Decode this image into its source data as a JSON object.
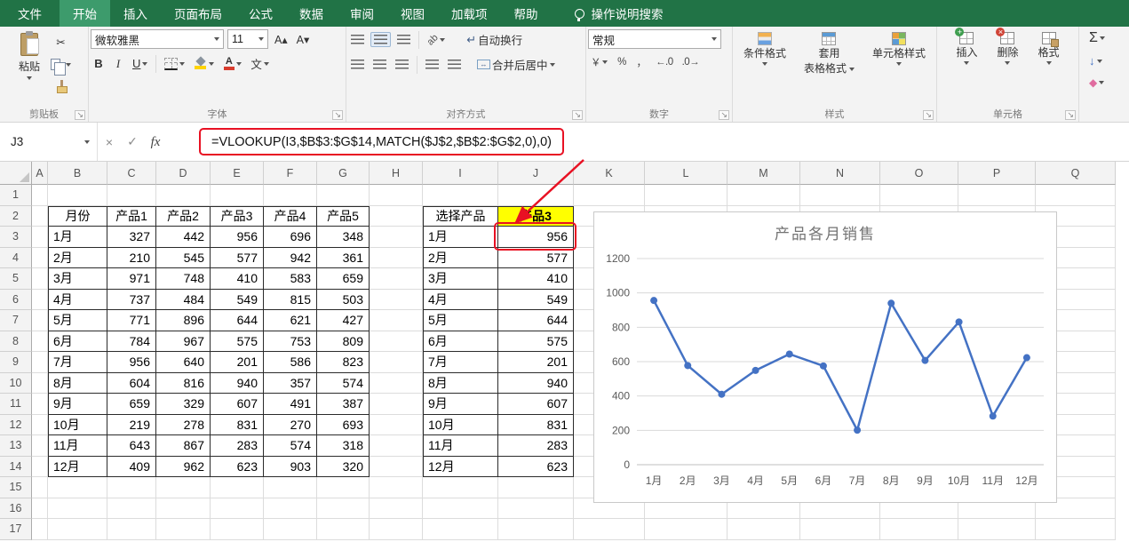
{
  "colors": {
    "accent_green": "#217346",
    "accent_green_light": "#3d9b6c",
    "annotation_red": "#e81123",
    "highlight_yellow": "#ffff00"
  },
  "tabs": {
    "items": [
      {
        "id": "file",
        "label": "文件"
      },
      {
        "id": "home",
        "label": "开始",
        "active": true
      },
      {
        "id": "insert",
        "label": "插入"
      },
      {
        "id": "page-layout",
        "label": "页面布局"
      },
      {
        "id": "formulas",
        "label": "公式"
      },
      {
        "id": "data",
        "label": "数据"
      },
      {
        "id": "review",
        "label": "审阅"
      },
      {
        "id": "view",
        "label": "视图"
      },
      {
        "id": "add-ins",
        "label": "加载项"
      },
      {
        "id": "help",
        "label": "帮助"
      }
    ],
    "search_label": "操作说明搜索"
  },
  "ribbon": {
    "paste": "粘贴",
    "font_name": "微软雅黑",
    "font_size": "11",
    "wrap_text": "自动换行",
    "merge_center": "合并后居中",
    "number_format": "常规",
    "cond_format": "条件格式",
    "table_format_line1": "套用",
    "table_format_line2": "表格格式",
    "cell_styles": "单元格样式",
    "insert": "插入",
    "delete": "删除",
    "format": "格式",
    "groups": {
      "clipboard": "剪贴板",
      "font": "字体",
      "alignment": "对齐方式",
      "number": "数字",
      "styles": "样式",
      "cells": "单元格"
    }
  },
  "icons": {
    "scissors": "✂",
    "cancel": "×",
    "enter": "✓",
    "fx": "fx",
    "sigma": "Σ",
    "launcher": "↘",
    "bold": "B",
    "italic": "I",
    "underline": "U",
    "grow_font": "A▴",
    "shrink_font": "A▾",
    "wrap": "↵",
    "merge": "↔",
    "currency": "￥",
    "percent": "%",
    "comma": "，",
    "inc_decimal": "←.0",
    "dec_decimal": ".0→",
    "orientation": "ab",
    "phonetic": "文",
    "fill_down": "↓",
    "eraser": "◆"
  },
  "formula_bar": {
    "name_box": "J3",
    "formula": "=VLOOKUP(I3,$B$3:$G$14,MATCH($J$2,$B$2:$G$2,0),0)"
  },
  "grid": {
    "columns": [
      "A",
      "B",
      "C",
      "D",
      "E",
      "F",
      "G",
      "H",
      "I",
      "J",
      "K",
      "L",
      "M",
      "N",
      "O",
      "P",
      "Q"
    ],
    "rows": [
      "1",
      "2",
      "3",
      "4",
      "5",
      "6",
      "7",
      "8",
      "9",
      "10",
      "11",
      "12",
      "13",
      "14",
      "15",
      "16",
      "17"
    ]
  },
  "data_table": {
    "headers": [
      "月份",
      "产品1",
      "产品2",
      "产品3",
      "产品4",
      "产品5"
    ],
    "rows": [
      [
        "1月",
        327,
        442,
        956,
        696,
        348
      ],
      [
        "2月",
        210,
        545,
        577,
        942,
        361
      ],
      [
        "3月",
        971,
        748,
        410,
        583,
        659
      ],
      [
        "4月",
        737,
        484,
        549,
        815,
        503
      ],
      [
        "5月",
        771,
        896,
        644,
        621,
        427
      ],
      [
        "6月",
        784,
        967,
        575,
        753,
        809
      ],
      [
        "7月",
        956,
        640,
        201,
        586,
        823
      ],
      [
        "8月",
        604,
        816,
        940,
        357,
        574
      ],
      [
        "9月",
        659,
        329,
        607,
        491,
        387
      ],
      [
        "10月",
        219,
        278,
        831,
        270,
        693
      ],
      [
        "11月",
        643,
        867,
        283,
        574,
        318
      ],
      [
        "12月",
        409,
        962,
        623,
        903,
        320
      ]
    ]
  },
  "lookup_table": {
    "headers": [
      "选择产品",
      "产品3"
    ],
    "rows": [
      [
        "1月",
        956
      ],
      [
        "2月",
        577
      ],
      [
        "3月",
        410
      ],
      [
        "4月",
        549
      ],
      [
        "5月",
        644
      ],
      [
        "6月",
        575
      ],
      [
        "7月",
        201
      ],
      [
        "8月",
        940
      ],
      [
        "9月",
        607
      ],
      [
        "10月",
        831
      ],
      [
        "11月",
        283
      ],
      [
        "12月",
        623
      ]
    ]
  },
  "chart_data": {
    "type": "line",
    "title": "产品各月销售",
    "categories": [
      "1月",
      "2月",
      "3月",
      "4月",
      "5月",
      "6月",
      "7月",
      "8月",
      "9月",
      "10月",
      "11月",
      "12月"
    ],
    "values": [
      956,
      577,
      410,
      549,
      644,
      575,
      201,
      940,
      607,
      831,
      283,
      623
    ],
    "xlabel": "",
    "ylabel": "",
    "ylim": [
      0,
      1200
    ],
    "yticks": [
      0,
      200,
      400,
      600,
      800,
      1000,
      1200
    ],
    "grid": true,
    "legend": false,
    "line_color": "#4472c4",
    "marker": "circle"
  }
}
